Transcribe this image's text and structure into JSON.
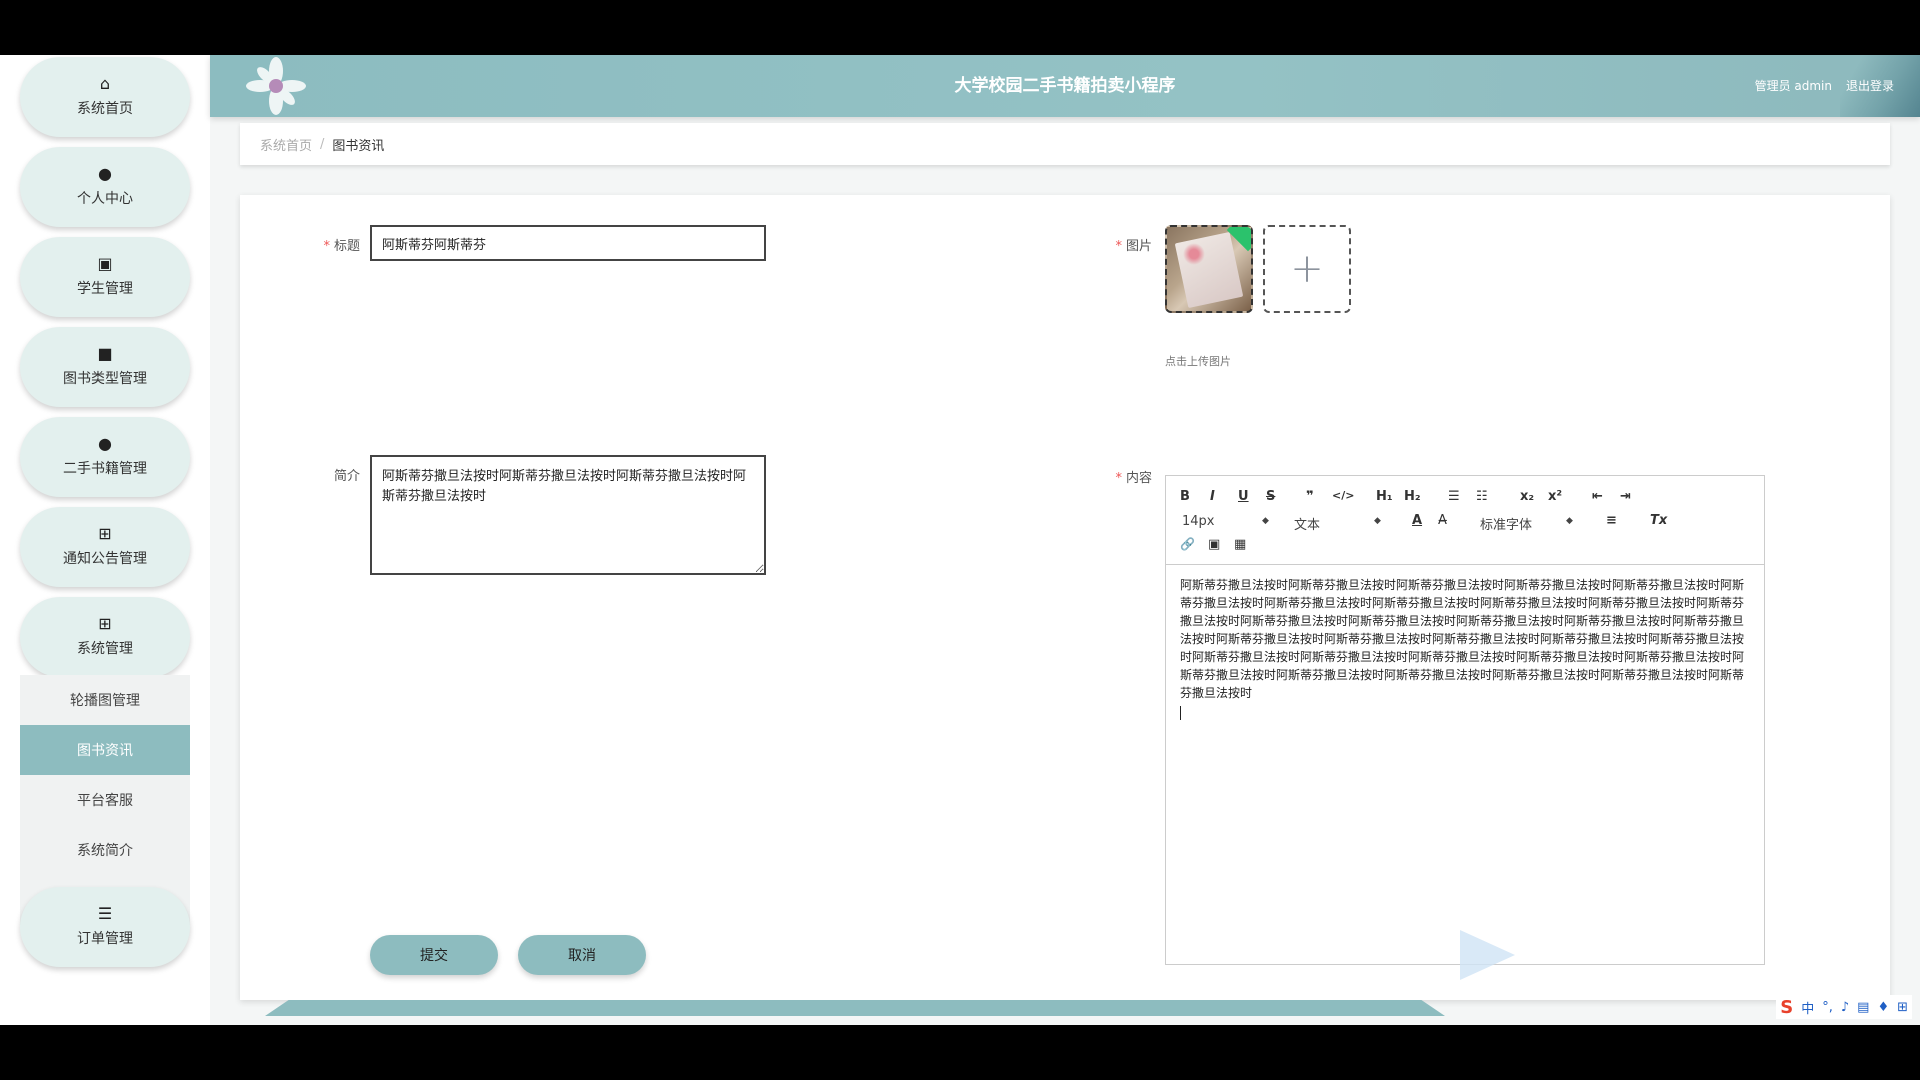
{
  "header": {
    "title": "大学校园二手书籍拍卖小程序",
    "user": "管理员 admin",
    "logout": "退出登录"
  },
  "sidebar": {
    "items": [
      {
        "label": "系统首页",
        "icon": "home-icon"
      },
      {
        "label": "个人中心",
        "icon": "user-icon"
      },
      {
        "label": "学生管理",
        "icon": "clipboard-icon"
      },
      {
        "label": "图书类型管理",
        "icon": "video-icon"
      },
      {
        "label": "二手书籍管理",
        "icon": "user-icon"
      },
      {
        "label": "通知公告管理",
        "icon": "grid-icon"
      },
      {
        "label": "系统管理",
        "icon": "grid-icon"
      },
      {
        "label": "订单管理",
        "icon": "list-icon"
      }
    ],
    "submenu": [
      "轮播图管理",
      "图书资讯",
      "平台客服",
      "系统简介"
    ],
    "active_submenu": "图书资讯"
  },
  "breadcrumb": {
    "home": "系统首页",
    "separator": "/",
    "current": "图书资讯"
  },
  "form": {
    "title_label": "标题",
    "title_value": "阿斯蒂芬阿斯蒂芬",
    "intro_label": "简介",
    "intro_value": "阿斯蒂芬撒旦法按时阿斯蒂芬撒旦法按时阿斯蒂芬撒旦法按时阿斯蒂芬撒旦法按时",
    "image_label": "图片",
    "upload_tip": "点击上传图片",
    "add_symbol": "+",
    "content_label": "内容",
    "content_value": "阿斯蒂芬撒旦法按时阿斯蒂芬撒旦法按时阿斯蒂芬撒旦法按时阿斯蒂芬撒旦法按时阿斯蒂芬撒旦法按时阿斯蒂芬撒旦法按时阿斯蒂芬撒旦法按时阿斯蒂芬撒旦法按时阿斯蒂芬撒旦法按时阿斯蒂芬撒旦法按时阿斯蒂芬撒旦法按时阿斯蒂芬撒旦法按时阿斯蒂芬撒旦法按时阿斯蒂芬撒旦法按时阿斯蒂芬撒旦法按时阿斯蒂芬撒旦法按时阿斯蒂芬撒旦法按时阿斯蒂芬撒旦法按时阿斯蒂芬撒旦法按时阿斯蒂芬撒旦法按时阿斯蒂芬撒旦法按时阿斯蒂芬撒旦法按时阿斯蒂芬撒旦法按时阿斯蒂芬撒旦法按时阿斯蒂芬撒旦法按时阿斯蒂芬撒旦法按时阿斯蒂芬撒旦法按时阿斯蒂芬撒旦法按时阿斯蒂芬撒旦法按时阿斯蒂芬撒旦法按时阿斯蒂芬撒旦法按时阿斯蒂芬撒旦法按时",
    "submit": "提交",
    "cancel": "取消"
  },
  "editor_toolbar": {
    "bold": "B",
    "italic": "I",
    "underline": "U",
    "strike": "S",
    "quote": "❞",
    "code": "</>",
    "h1": "H₁",
    "h2": "H₂",
    "ordered_list": "☰",
    "bullet_list": "☷",
    "sub": "x₂",
    "sup": "x²",
    "outdent": "⇤",
    "indent": "⇥",
    "font_size": "14px",
    "header_select": "文本",
    "font_family": "标准字体",
    "color": "A",
    "background": "A̶",
    "align": "≡",
    "clean": "Tx",
    "link": "🔗",
    "image": "▣",
    "video": "▦"
  },
  "ime": {
    "logo": "S",
    "mode": "中"
  },
  "colors": {
    "accent": "#8dbcbf",
    "pill": "#e3f0ee",
    "required": "#ee5555"
  }
}
